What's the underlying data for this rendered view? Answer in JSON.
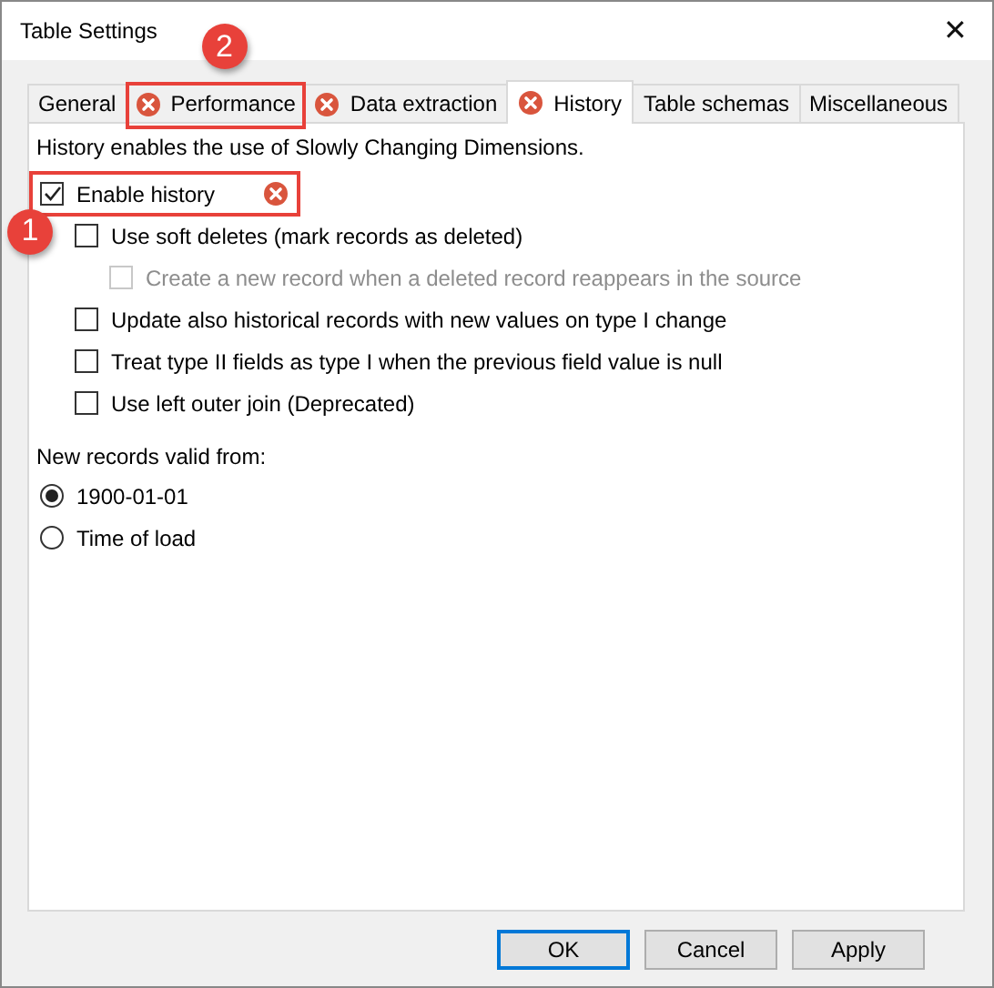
{
  "window": {
    "title": "Table Settings",
    "close": "✕"
  },
  "tabs": [
    {
      "label": "General",
      "selected": false,
      "error": false,
      "highlighted": false
    },
    {
      "label": "Performance",
      "selected": false,
      "error": true,
      "highlighted": true,
      "callout": "2"
    },
    {
      "label": "Data extraction",
      "selected": false,
      "error": true,
      "highlighted": false
    },
    {
      "label": "History",
      "selected": true,
      "error": true,
      "highlighted": false
    },
    {
      "label": "Table schemas",
      "selected": false,
      "error": false,
      "highlighted": false
    },
    {
      "label": "Miscellaneous",
      "selected": false,
      "error": false,
      "highlighted": false
    }
  ],
  "description": "History enables the use of Slowly Changing Dimensions.",
  "options": [
    {
      "label": "Enable history",
      "checked": true,
      "disabled": false,
      "error": true,
      "highlighted": true,
      "callout": "1",
      "children": [
        {
          "label": "Use soft deletes (mark records as deleted)",
          "checked": false,
          "disabled": false,
          "error": false,
          "highlighted": false,
          "children": [
            {
              "label": "Create a new record when a deleted record reappears in the source",
              "checked": false,
              "disabled": true,
              "error": false,
              "highlighted": false
            }
          ]
        },
        {
          "label": "Update also historical records with new values on type I change",
          "checked": false,
          "disabled": false,
          "error": false,
          "highlighted": false
        },
        {
          "label": "Treat type II fields as type I when the previous field value is null",
          "checked": false,
          "disabled": false,
          "error": false,
          "highlighted": false
        },
        {
          "label": "Use left outer join (Deprecated)",
          "checked": false,
          "disabled": false,
          "error": false,
          "highlighted": false
        }
      ]
    }
  ],
  "valid_from": {
    "label": "New records valid from:",
    "choices": [
      {
        "label": "1900-01-01",
        "selected": true
      },
      {
        "label": "Time of load",
        "selected": false
      }
    ]
  },
  "buttons": [
    {
      "label": "OK",
      "default": true
    },
    {
      "label": "Cancel",
      "default": false
    },
    {
      "label": "Apply",
      "default": false
    }
  ]
}
